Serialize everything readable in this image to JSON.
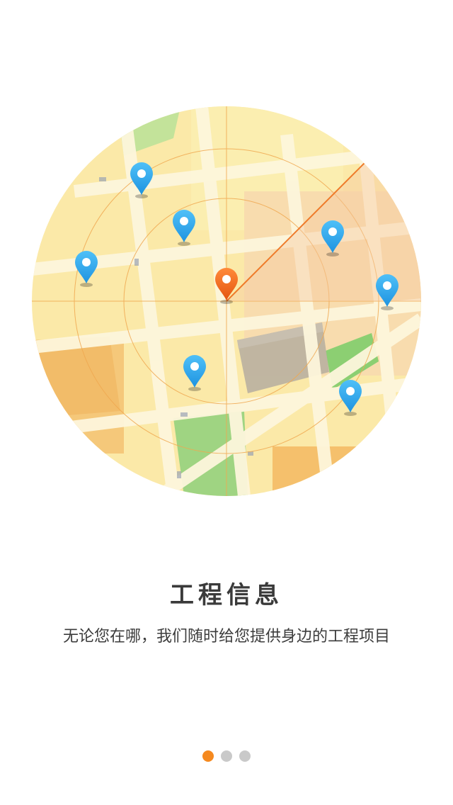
{
  "onboarding": {
    "title": "工程信息",
    "subtitle": "无论您在哪，我们随时给您提供身边的工程项目",
    "page_indicator": {
      "total": 3,
      "active_index": 0
    }
  },
  "colors": {
    "accent": "#f5891f",
    "pin_blue": "#2ea7ee",
    "pin_orange": "#f06a1a",
    "map_base": "#fbe9a8",
    "inactive_dot": "#c9c9c9"
  },
  "icons": [
    "location-pin-icon",
    "current-location-pin-icon"
  ]
}
